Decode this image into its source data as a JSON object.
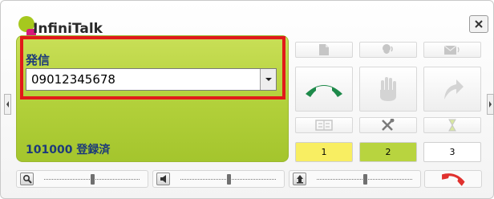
{
  "app": {
    "title": "InfiniTalk"
  },
  "dial": {
    "label": "発信",
    "number": "09012345678"
  },
  "status": {
    "text": "101000 登録済"
  },
  "line_buttons": [
    {
      "label": "1",
      "color": "#f8ee62"
    },
    {
      "label": "2",
      "color": "#b8d43f"
    },
    {
      "label": "3",
      "color": "#ffffff"
    }
  ],
  "sliders": [
    {
      "icon": "search-icon",
      "level": 0.5
    },
    {
      "icon": "speaker-icon",
      "level": 0.5
    },
    {
      "icon": "microphone-icon",
      "level": 0.5
    }
  ],
  "icons": {
    "top_row": [
      "document-icon",
      "person-speaking-icon",
      "envelope-icon"
    ],
    "middle_row": [
      "phone-answer-icon",
      "hold-hand-icon",
      "transfer-arrow-icon"
    ],
    "bottom_row": [
      "phonebook-icon",
      "tools-icon",
      "hourglass-icon"
    ],
    "hangup": "phone-hangup-icon",
    "close": "close-icon"
  },
  "colors": {
    "panel_green": "#b2d03a",
    "highlight_red": "#e11a1a",
    "answer_green": "#1e8a4a",
    "hangup_red": "#e0312e"
  }
}
